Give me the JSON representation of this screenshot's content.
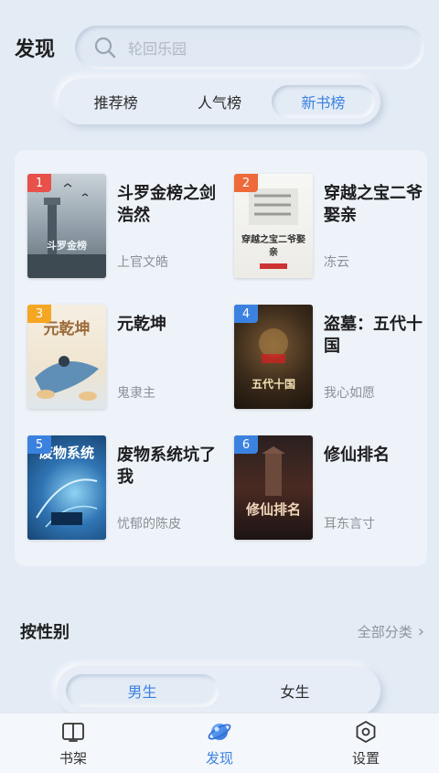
{
  "header": {
    "title": "发现",
    "search_placeholder": "轮回乐园"
  },
  "rank_tabs": [
    "推荐榜",
    "人气榜",
    "新书榜"
  ],
  "rank_tabs_active": "新书榜",
  "books": [
    {
      "rank": "1",
      "title": "斗罗金榜之剑浩然",
      "author": "上官文皓",
      "cover_text": "斗罗金榜",
      "badge_color": "#e8504a"
    },
    {
      "rank": "2",
      "title": "穿越之宝二爷娶亲",
      "author": "冻云",
      "cover_text": "穿越之宝二爷娶亲",
      "badge_color": "#ee6a3a"
    },
    {
      "rank": "3",
      "title": "元乾坤",
      "author": "鬼隶主",
      "cover_text": "元乾坤",
      "badge_color": "#f5a623"
    },
    {
      "rank": "4",
      "title": "盗墓：五代十国",
      "author": "我心如愿",
      "cover_text": "五代十国",
      "badge_color": "#3b82e0"
    },
    {
      "rank": "5",
      "title": "废物系统坑了我",
      "author": "忧郁的陈皮",
      "cover_text": "废物系统",
      "badge_color": "#3b82e0"
    },
    {
      "rank": "6",
      "title": "修仙排名",
      "author": "耳东言寸",
      "cover_text": "修仙排名",
      "badge_color": "#3b82e0"
    }
  ],
  "gender_section": {
    "title": "按性别",
    "all_categories": "全部分类",
    "tabs": [
      "男生",
      "女生"
    ],
    "active": "男生"
  },
  "bottom_nav": [
    {
      "label": "书架",
      "icon": "book-open-icon"
    },
    {
      "label": "发现",
      "icon": "planet-icon"
    },
    {
      "label": "设置",
      "icon": "settings-hexagon-icon"
    }
  ],
  "bottom_nav_active": "发现",
  "colors": {
    "accent": "#3b82e0",
    "background": "#e3ebf5"
  }
}
